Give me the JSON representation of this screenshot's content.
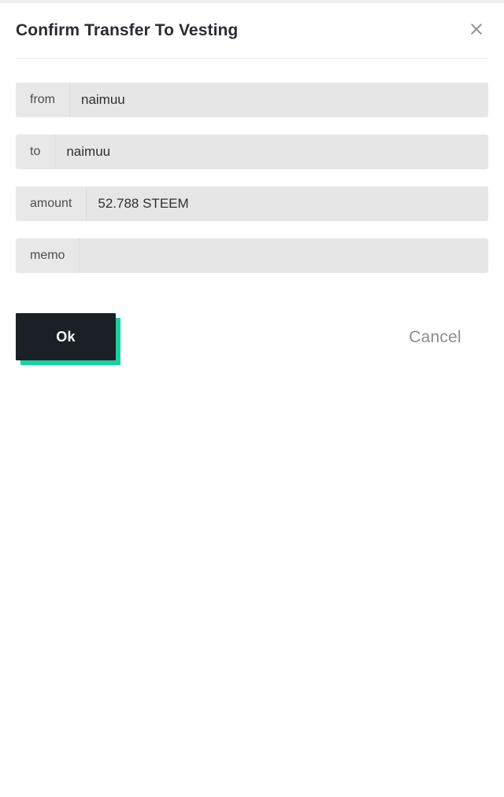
{
  "dialog": {
    "title": "Confirm Transfer To Vesting",
    "close_icon": "close-icon"
  },
  "fields": [
    {
      "label": "from",
      "value": "naimuu",
      "placeholder": ""
    },
    {
      "label": "to",
      "value": "naimuu",
      "placeholder": ""
    },
    {
      "label": "amount",
      "value": "52.788 STEEM",
      "placeholder": ""
    },
    {
      "label": "memo",
      "value": "",
      "placeholder": ""
    }
  ],
  "actions": {
    "confirm_label": "Ok",
    "cancel_label": "Cancel"
  },
  "colors": {
    "accent": "#1bd0a0",
    "button_dark": "#1b2026",
    "title_text": "#2a2d31",
    "field_bg": "#e6e6e6",
    "label_bg": "#e8e8e8",
    "cancel_text": "#8a8d91"
  }
}
